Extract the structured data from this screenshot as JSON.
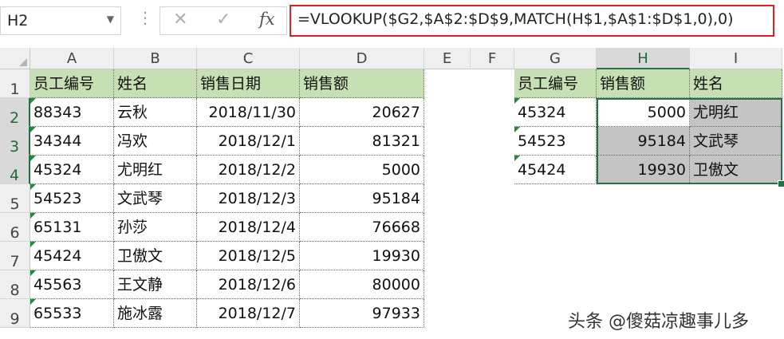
{
  "formula_bar": {
    "name_box": "H2",
    "cancel_icon": "✕",
    "enter_icon": "✓",
    "fx_label": "fx",
    "formula": "=VLOOKUP($G2,$A$2:$D$9,MATCH(H$1,$A$1:$D$1,0),0)"
  },
  "columns": [
    "A",
    "B",
    "C",
    "D",
    "E",
    "F",
    "G",
    "H",
    "I"
  ],
  "rows": [
    "1",
    "2",
    "3",
    "4",
    "5",
    "6",
    "7",
    "8",
    "9"
  ],
  "table1": {
    "headers": [
      "员工编号",
      "姓名",
      "销售日期",
      "销售额"
    ],
    "rows": [
      [
        "88343",
        "云秋",
        "2018/11/30",
        "20627"
      ],
      [
        "34344",
        "冯欢",
        "2018/12/1",
        "81321"
      ],
      [
        "45324",
        "尤明红",
        "2018/12/2",
        "5000"
      ],
      [
        "54523",
        "文武琴",
        "2018/12/3",
        "95184"
      ],
      [
        "65131",
        "孙莎",
        "2018/12/4",
        "76668"
      ],
      [
        "45424",
        "卫傲文",
        "2018/12/5",
        "19930"
      ],
      [
        "45563",
        "王文静",
        "2018/12/6",
        "80000"
      ],
      [
        "65533",
        "施冰露",
        "2018/12/7",
        "97933"
      ]
    ]
  },
  "table2": {
    "headers": [
      "员工编号",
      "销售额",
      "姓名"
    ],
    "rows": [
      [
        "45324",
        "5000",
        "尤明红"
      ],
      [
        "54523",
        "95184",
        "文武琴"
      ],
      [
        "45424",
        "19930",
        "卫傲文"
      ]
    ]
  },
  "selection": {
    "active_cell": "H2",
    "range": "H2:I4"
  },
  "colors": {
    "header_fill": "#c6e0b4",
    "selection_fill": "#c4c4c4",
    "accent": "#217346",
    "formula_border": "#e02020"
  },
  "watermark": "头条 @傻菇凉趣事儿多"
}
